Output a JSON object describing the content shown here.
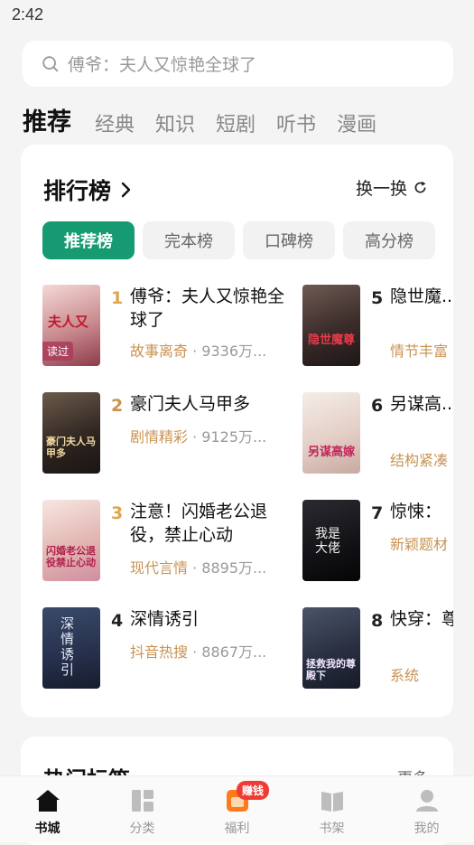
{
  "status_bar": {
    "time": "2:42"
  },
  "search": {
    "placeholder": "傅爷：夫人又惊艳全球了"
  },
  "tabs": [
    "推荐",
    "经典",
    "知识",
    "短剧",
    "听书",
    "漫画"
  ],
  "ranking": {
    "title": "排行榜",
    "refresh_label": "换一换",
    "chips": [
      "推荐榜",
      "完本榜",
      "口碑榜",
      "高分榜"
    ],
    "books": [
      {
        "rank": "1",
        "title": "傅爷：夫人又惊艳全球了",
        "tag": "故事离奇",
        "reads": "9336万...",
        "cover_text": "夫人又",
        "cover_badge": "读过",
        "rank_color": "#e0a64d"
      },
      {
        "rank": "2",
        "title": "豪门夫人马甲多",
        "tag": "剧情精彩",
        "reads": "9125万...",
        "cover_text": "豪门夫人马甲多",
        "rank_color": "#c99352"
      },
      {
        "rank": "3",
        "title": "注意！闪婚老公退役，禁止心动",
        "tag": "现代言情",
        "reads": "8895万...",
        "cover_text": "闪婚老公退役禁止心动",
        "rank_color": "#e0a64d"
      },
      {
        "rank": "4",
        "title": "深情诱引",
        "tag": "抖音热搜",
        "reads": "8867万...",
        "cover_text": "深情诱引",
        "rank_color": "#222222"
      },
      {
        "rank": "5",
        "title": "隐世魔...娃上门",
        "tag": "情节丰富",
        "reads": "",
        "cover_text": "隐世魔尊",
        "rank_color": "#222222"
      },
      {
        "rank": "6",
        "title": "另谋高...夫人我",
        "tag": "结构紧凑",
        "reads": "",
        "cover_text": "另谋高嫁",
        "rank_color": "#222222"
      },
      {
        "rank": "7",
        "title": "惊悚：",
        "tag": "新颖题材",
        "reads": "",
        "cover_text": "我是大佬",
        "rank_color": "#222222"
      },
      {
        "rank": "8",
        "title": "快穿：尊殿下",
        "tag": "系统",
        "reads": "",
        "cover_text": "拯救我的尊殿下",
        "rank_color": "#222222"
      }
    ]
  },
  "hot_tags": {
    "title": "热门标签",
    "more": "更多"
  },
  "bottom_nav": [
    {
      "label": "书城",
      "icon": "home-icon"
    },
    {
      "label": "分类",
      "icon": "category-icon"
    },
    {
      "label": "福利",
      "icon": "gift-icon",
      "badge": "赚钱"
    },
    {
      "label": "书架",
      "icon": "bookshelf-icon"
    },
    {
      "label": "我的",
      "icon": "profile-icon"
    }
  ],
  "colors": {
    "accent": "#169a72",
    "tag": "#c99352",
    "badge": "#ef3b35"
  }
}
